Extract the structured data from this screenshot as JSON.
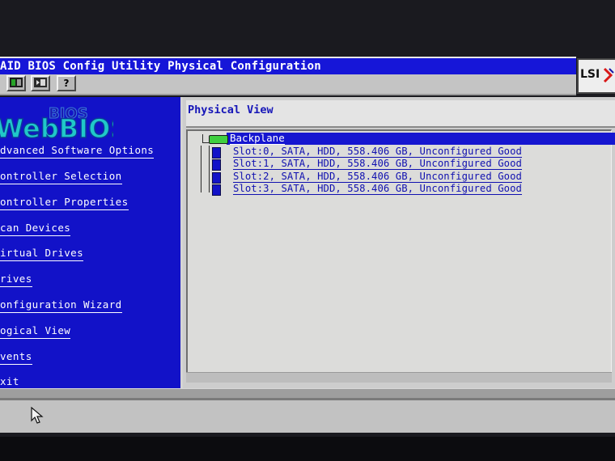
{
  "window": {
    "title": "AID BIOS Config Utility  Physical Configuration",
    "vendor_logo": "LSI"
  },
  "toolbar": {
    "buttons": [
      {
        "name": "home-icon"
      },
      {
        "name": "exit-icon"
      },
      {
        "name": "help-icon",
        "glyph": "?"
      }
    ]
  },
  "nav": {
    "logo_text": "WebBIOS",
    "items": [
      {
        "label": "dvanced Software Options"
      },
      {
        "label": "ontroller Selection"
      },
      {
        "label": "ontroller Properties"
      },
      {
        "label": "can Devices"
      },
      {
        "label": "irtual Drives"
      },
      {
        "label": "rives"
      },
      {
        "label": "onfiguration Wizard"
      },
      {
        "label": "ogical View"
      },
      {
        "label": "vents"
      },
      {
        "label": "xit"
      }
    ]
  },
  "content": {
    "title": "Physical View",
    "tree": {
      "backplane_label": "Backplane",
      "drives": [
        {
          "label": "Slot:0, SATA, HDD, 558.406 GB, Unconfigured Good"
        },
        {
          "label": "Slot:1, SATA, HDD, 558.406 GB, Unconfigured Good"
        },
        {
          "label": "Slot:2, SATA, HDD, 558.406 GB, Unconfigured Good"
        },
        {
          "label": "Slot:3, SATA, HDD, 558.406 GB, Unconfigured Good"
        }
      ]
    }
  },
  "colors": {
    "accent": "#1616d8",
    "nav_background": "#1212c8",
    "drive_text": "#1010b0",
    "backplane_icon": "#3fcf3f"
  }
}
